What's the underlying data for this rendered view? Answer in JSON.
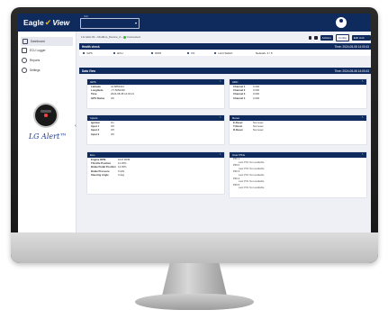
{
  "brand": {
    "name": "Eagle",
    "name2": "View"
  },
  "top_select": {
    "label": "Unit",
    "value": ""
  },
  "nav": [
    {
      "label": "Dashboard",
      "icon": "dashboard-icon",
      "active": true
    },
    {
      "label": "ECU Logger",
      "icon": "list-icon",
      "active": false
    },
    {
      "label": "Reports",
      "icon": "report-icon",
      "active": false
    },
    {
      "label": "Settings",
      "icon": "gear-icon",
      "active": false
    }
  ],
  "device": {
    "brand_text": "LG Alert™"
  },
  "breadcrumb": {
    "text": "LG Alert-01 › Modbus_Device_2 ›",
    "status": "Connected"
  },
  "toolbar": {
    "btn1": "Actions",
    "btn2": "Config",
    "btn3": "Edit Unit Name"
  },
  "health": {
    "title": "Health check",
    "time": "Time: 2024-08-08 14:03:43",
    "items": [
      "GPS",
      "ECU",
      "RPM",
      "I/O",
      "Limit Switch",
      "Network: 4 / 5"
    ]
  },
  "datebar": {
    "title": "Data View",
    "time": "Time: 2024-08-08 14:03:43"
  },
  "gps": {
    "title": "GPS",
    "rows": [
      {
        "k": "Latitude",
        "v": "41.8853344"
      },
      {
        "k": "Longitude",
        "v": "-77.5050349"
      },
      {
        "k": "Time",
        "v": "2024-08-08 14:03:21"
      },
      {
        "k": "GPS Status",
        "v": "OK"
      }
    ]
  },
  "adc": {
    "title": "ADC",
    "rows": [
      {
        "k": "Channel 1",
        "v": "0.000"
      },
      {
        "k": "Channel 2",
        "v": "0.000"
      },
      {
        "k": "Channel 3",
        "v": "0.000"
      },
      {
        "k": "Channel 4",
        "v": "0.000"
      }
    ]
  },
  "inputs": {
    "title": "Inputs",
    "rows": [
      {
        "k": "Ignition",
        "v": "On"
      },
      {
        "k": "Input 1",
        "v": "Off"
      },
      {
        "k": "Input 2",
        "v": "Off"
      },
      {
        "k": "Input 3",
        "v": "Off"
      }
    ]
  },
  "reset": {
    "title": "Reset",
    "rows": [
      {
        "k": "E-Reset",
        "v": "Not reset"
      },
      {
        "k": "T-Reset",
        "v": "Not reset"
      },
      {
        "k": "R-Reset",
        "v": "Not reset"
      }
    ]
  },
  "ecu": {
    "title": "Ecu",
    "rows": [
      {
        "k": "Engine RPM",
        "v": "1047 RPM"
      },
      {
        "k": "Throttle Position",
        "v": "14.36%"
      },
      {
        "k": "Brake Pedal Position",
        "v": "14.36%"
      },
      {
        "k": "Brake Pressure",
        "v": "0 kPa"
      },
      {
        "k": "Steering Angle",
        "v": "0 deg"
      }
    ]
  },
  "user_pins": {
    "title": "User PINs",
    "events": [
      {
        "label": "PIN 1",
        "detail": "Last PIN: Not available"
      },
      {
        "label": "PIN 2",
        "detail": "Last PIN: Not available"
      },
      {
        "label": "PIN 3",
        "detail": "Last PIN: Not available"
      },
      {
        "label": "PIN 4",
        "detail": "Last PIN: Not available"
      },
      {
        "label": "PIN 5",
        "detail": "Last PIN: Not available"
      }
    ]
  },
  "colors": {
    "navy": "#0f2a5c",
    "accent": "#f5b400",
    "ok": "#2eb82e"
  }
}
